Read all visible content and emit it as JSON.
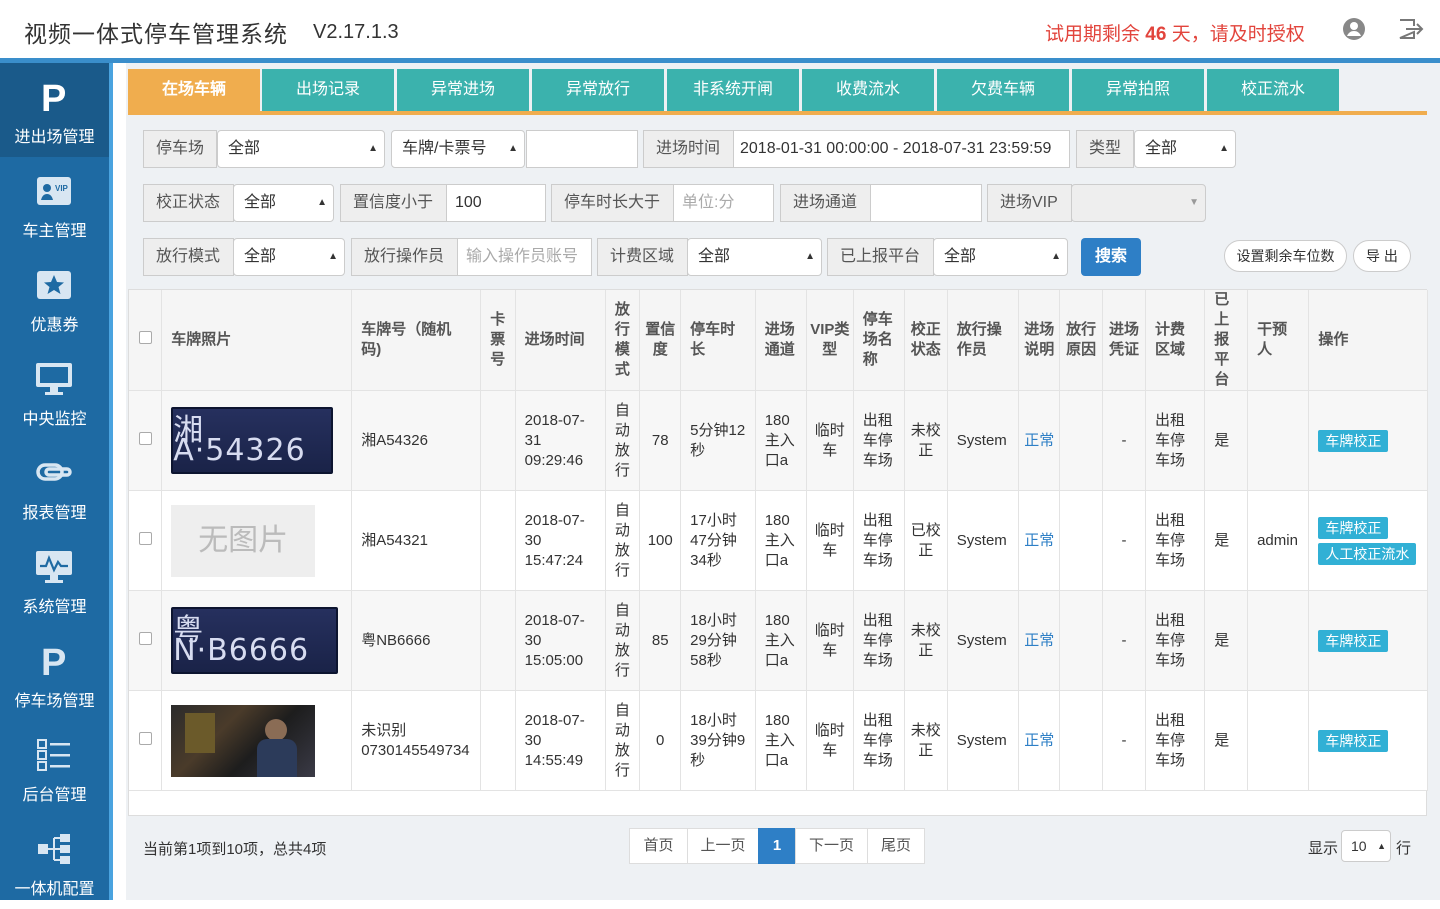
{
  "header": {
    "title": "视频一体式停车管理系统",
    "version": "V2.17.1.3",
    "trial_prefix": "试用期剩余 ",
    "trial_days": "46",
    "trial_suffix": " 天，请及时授权"
  },
  "sidebar": {
    "items": [
      {
        "label": "进出场管理",
        "icon": "parking-p-icon"
      },
      {
        "label": "车主管理",
        "icon": "vip-card-icon"
      },
      {
        "label": "优惠券",
        "icon": "coupon-star-icon"
      },
      {
        "label": "中央监控",
        "icon": "monitor-icon"
      },
      {
        "label": "报表管理",
        "icon": "report-link-icon"
      },
      {
        "label": "系统管理",
        "icon": "system-monitor-icon"
      },
      {
        "label": "停车场管理",
        "icon": "parking-p-icon"
      },
      {
        "label": "后台管理",
        "icon": "list-icon"
      },
      {
        "label": "一体机配置",
        "icon": "sitemap-icon"
      }
    ]
  },
  "tabs": [
    "在场车辆",
    "出场记录",
    "异常进场",
    "异常放行",
    "非系统开闸",
    "收费流水",
    "欠费车辆",
    "异常拍照",
    "校正流水"
  ],
  "filters": {
    "parking_lot_label": "停车场",
    "parking_lot_value": "全部",
    "plate_type_value": "车牌/卡票号",
    "plate_input_value": "",
    "entry_time_label": "进场时间",
    "entry_time_value": "2018-01-31 00:00:00 - 2018-07-31 23:59:59",
    "type_label": "类型",
    "type_value": "全部",
    "correction_label": "校正状态",
    "correction_value": "全部",
    "confidence_label": "置信度小于",
    "confidence_value": "100",
    "duration_label": "停车时长大于",
    "duration_placeholder": "单位:分",
    "channel_label": "进场通道",
    "channel_value": "",
    "vip_label": "进场VIP",
    "vip_value": "",
    "release_mode_label": "放行模式",
    "release_mode_value": "全部",
    "operator_label": "放行操作员",
    "operator_placeholder": "输入操作员账号",
    "billing_area_label": "计费区域",
    "billing_area_value": "全部",
    "reported_label": "已上报平台",
    "reported_value": "全部",
    "search_label": "搜索",
    "set_spaces_label": "设置剩余车位数",
    "export_label": "导 出"
  },
  "table": {
    "columns": [
      "车牌照片",
      "车牌号（随机码)",
      "卡票号",
      "进场时间",
      "放行模式",
      "置信度",
      "停车时长",
      "进场通道",
      "VIP类型",
      "停车场名称",
      "校正状态",
      "放行操作员",
      "进场说明",
      "放行原因",
      "进场凭证",
      "计费区域",
      "已上报平台",
      "干预人",
      "操作"
    ],
    "rows": [
      {
        "photo": "plate",
        "photo_text": "湘A·54326",
        "plate": "湘A54326",
        "card": "",
        "time": "2018-07-31 09:29:46",
        "mode": "自动放行",
        "confidence": "78",
        "duration": "5分钟12秒",
        "channel": "180主入口a",
        "vip": "临时车",
        "lot": "出租车停车场",
        "corrected": "未校正",
        "operator": "System",
        "note": "正常",
        "reason": "",
        "voucher": "-",
        "area": "出租车停车场",
        "reported": "是",
        "intervener": "",
        "actions": [
          "车牌校正"
        ]
      },
      {
        "photo": "none",
        "photo_text": "无图片",
        "plate": "湘A54321",
        "card": "",
        "time": "2018-07-30 15:47:24",
        "mode": "自动放行",
        "confidence": "100",
        "duration": "17小时47分钟34秒",
        "channel": "180主入口a",
        "vip": "临时车",
        "lot": "出租车停车场",
        "corrected": "已校正",
        "operator": "System",
        "note": "正常",
        "reason": "",
        "voucher": "-",
        "area": "出租车停车场",
        "reported": "是",
        "intervener": "admin",
        "actions": [
          "车牌校正",
          "人工校正流水"
        ]
      },
      {
        "photo": "plate",
        "photo_text": "粤N·B6666",
        "plate": "粤NB6666",
        "card": "",
        "time": "2018-07-30 15:05:00",
        "mode": "自动放行",
        "confidence": "85",
        "duration": "18小时29分钟58秒",
        "channel": "180主入口a",
        "vip": "临时车",
        "lot": "出租车停车场",
        "corrected": "未校正",
        "operator": "System",
        "note": "正常",
        "reason": "",
        "voucher": "-",
        "area": "出租车停车场",
        "reported": "是",
        "intervener": "",
        "actions": [
          "车牌校正"
        ]
      },
      {
        "photo": "scene",
        "photo_text": "",
        "plate": "未识别 0730145549734",
        "card": "",
        "time": "2018-07-30 14:55:49",
        "mode": "自动放行",
        "confidence": "0",
        "duration": "18小时39分钟9秒",
        "channel": "180主入口a",
        "vip": "临时车",
        "lot": "出租车停车场",
        "corrected": "未校正",
        "operator": "System",
        "note": "正常",
        "reason": "",
        "voucher": "-",
        "area": "出租车停车场",
        "reported": "是",
        "intervener": "",
        "actions": [
          "车牌校正"
        ]
      }
    ]
  },
  "footer": {
    "page_info": "当前第1项到10项，总共4项",
    "first": "首页",
    "prev": "上一页",
    "current": "1",
    "next": "下一页",
    "last": "尾页",
    "show_label": "显示",
    "page_size": "10",
    "rows_label": "行"
  }
}
